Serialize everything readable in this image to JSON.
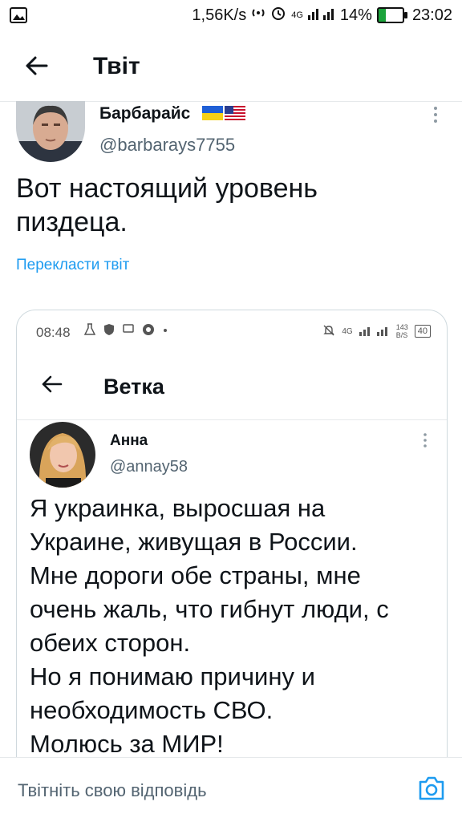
{
  "status_bar": {
    "network_speed": "1,56K/s",
    "network_type": "4G",
    "battery": "14%",
    "battery_level": 0.14,
    "time": "23:02"
  },
  "header": {
    "title": "Твіт"
  },
  "tweet": {
    "author_name": "Барбарайс",
    "author_handle": "@barbarays7755",
    "text_line1": "Вот настоящий уровень",
    "text_line2": "пиздеца.",
    "translate_label": "Перекласти твіт"
  },
  "embedded": {
    "status_time": "08:48",
    "network_type": "4G",
    "speed_top": "143",
    "speed_bottom": "B/S",
    "battery": "40",
    "header_title": "Ветка",
    "author_name": "Анна",
    "author_handle": "@annay58",
    "text_lines": [
      "Я украинка, выросшая на",
      "Украине, живущая в России.",
      "Мне дороги обе страны, мне",
      "очень жаль, что гибнут люди, с",
      "обеих сторон.",
      "Но я понимаю причину и",
      "необходимость СВО.",
      "Молюсь за МИР!"
    ]
  },
  "reply": {
    "placeholder": "Твітніть свою відповідь"
  },
  "colors": {
    "link": "#1d9bf0",
    "secondary_text": "#536471",
    "divider": "#e6e9eb",
    "battery_fill": "#1ba33b"
  }
}
